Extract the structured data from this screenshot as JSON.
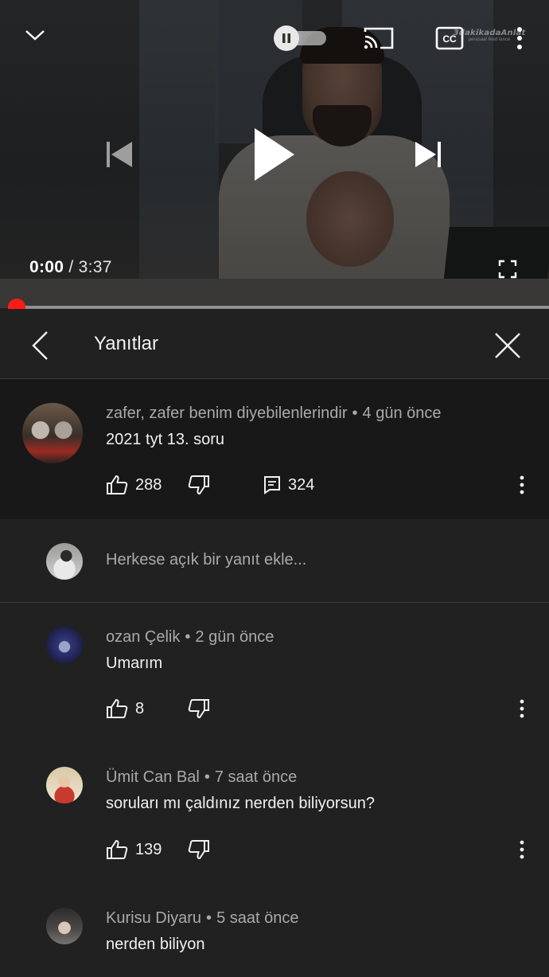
{
  "player": {
    "current_time": "0:00",
    "duration": "/ 3:37",
    "progress_fraction": 0.0,
    "autoplay": true,
    "watermark_text": "3dakikadaAnlat",
    "watermark_sub": "perasaal feed lance",
    "icons": {
      "collapse": "chevron-down-icon",
      "autoplay": "pause-icon",
      "cast": "cast-icon",
      "captions": "cc-icon",
      "more": "more-vert-icon",
      "previous": "skip-previous-icon",
      "play": "play-icon",
      "next": "skip-next-icon",
      "fullscreen": "fullscreen-icon"
    },
    "colors": {
      "progress": "#ff0000",
      "thumb": "#ff1a1a"
    }
  },
  "header": {
    "title": "Yanıtlar"
  },
  "parent_comment": {
    "author": "zafer, zafer benim diyebilenlerindir",
    "time": "4 gün önce",
    "text": "2021 tyt 13. soru",
    "likes": "288",
    "replies": "324"
  },
  "add_reply": {
    "placeholder": "Herkese açık bir yanıt ekle..."
  },
  "replies": [
    {
      "author": "ozan Çelik",
      "time": "2 gün önce",
      "text": "Umarım",
      "likes": "8"
    },
    {
      "author": "Ümit Can Bal",
      "time": "7 saat önce",
      "text": "soruları mı çaldınız nerden biliyorsun?",
      "likes": "139"
    },
    {
      "author": "Kurisu Diyaru",
      "time": "5 saat önce",
      "text": "nerden biliyon"
    }
  ]
}
